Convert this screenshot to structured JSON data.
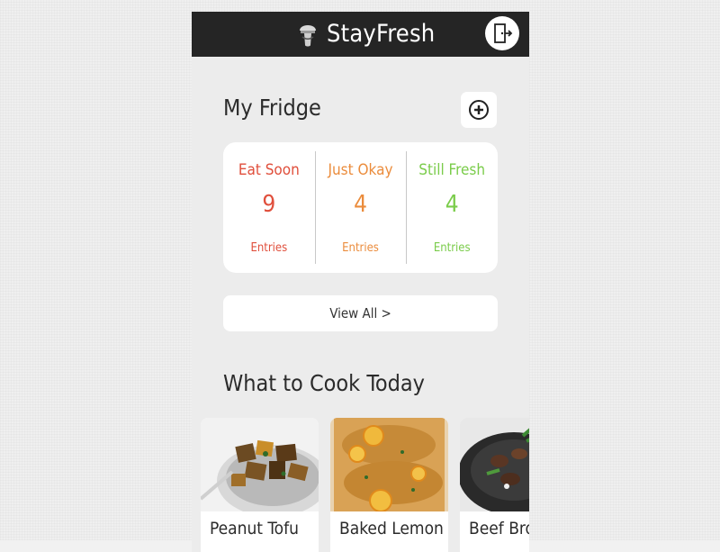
{
  "header": {
    "app_title": "StayFresh",
    "logo_icon": "mushroom-logo-icon",
    "logout_icon": "logout-door-icon"
  },
  "fridge": {
    "title": "My Fridge",
    "add_icon": "add-circle-icon",
    "columns": [
      {
        "label": "Eat Soon",
        "count": "9",
        "entries_label": "Entries",
        "color": "#e04f3c"
      },
      {
        "label": "Just Okay",
        "count": "4",
        "entries_label": "Entries",
        "color": "#eb8c3c"
      },
      {
        "label": "Still Fresh",
        "count": "4",
        "entries_label": "Entries",
        "color": "#7acc4a"
      }
    ],
    "view_all_label": "View All >"
  },
  "cook": {
    "title": "What to Cook Today",
    "recipes": [
      {
        "name": "Peanut Tofu"
      },
      {
        "name": "Baked Lemon"
      },
      {
        "name": "Beef Bro"
      }
    ]
  },
  "colors": {
    "header_bg": "#252525",
    "page_bg": "#ececec",
    "card_bg": "#ffffff"
  }
}
